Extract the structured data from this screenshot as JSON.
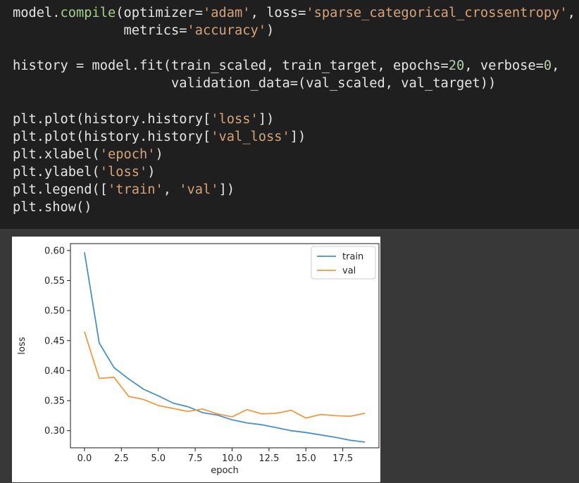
{
  "code_cell": {
    "lines": [
      [
        {
          "t": "model."
        },
        {
          "t": "compile",
          "k": "fn"
        },
        {
          "t": "(optimizer="
        },
        {
          "t": "'adam'",
          "k": "str"
        },
        {
          "t": ", loss="
        },
        {
          "t": "'sparse_categorical_crossentropy'",
          "k": "str"
        },
        {
          "t": ","
        }
      ],
      [
        {
          "t": "              metrics="
        },
        {
          "t": "'accuracy'",
          "k": "str"
        },
        {
          "t": ")"
        }
      ],
      [],
      [
        {
          "t": "history = model.fit(train_scaled, train_target, epochs="
        },
        {
          "t": "20",
          "k": "num"
        },
        {
          "t": ", verbose="
        },
        {
          "t": "0",
          "k": "num"
        },
        {
          "t": ","
        }
      ],
      [
        {
          "t": "                    validation_data=(val_scaled, val_target))"
        }
      ],
      [],
      [
        {
          "t": "plt.plot(history.history["
        },
        {
          "t": "'loss'",
          "k": "str"
        },
        {
          "t": "])"
        }
      ],
      [
        {
          "t": "plt.plot(history.history["
        },
        {
          "t": "'val_loss'",
          "k": "str"
        },
        {
          "t": "])"
        }
      ],
      [
        {
          "t": "plt.xlabel("
        },
        {
          "t": "'epoch'",
          "k": "str"
        },
        {
          "t": ")"
        }
      ],
      [
        {
          "t": "plt.ylabel("
        },
        {
          "t": "'loss'",
          "k": "str"
        },
        {
          "t": ")"
        }
      ],
      [
        {
          "t": "plt.legend(["
        },
        {
          "t": "'train'",
          "k": "str"
        },
        {
          "t": ", "
        },
        {
          "t": "'val'",
          "k": "str"
        },
        {
          "t": "])"
        }
      ],
      [
        {
          "t": "plt.show()"
        }
      ]
    ]
  },
  "chart_data": {
    "type": "line",
    "xlabel": "epoch",
    "ylabel": "loss",
    "xlim": [
      -0.95,
      19.95
    ],
    "ylim": [
      0.2715,
      0.6115
    ],
    "x_ticks": [
      0.0,
      2.5,
      5.0,
      7.5,
      10.0,
      12.5,
      15.0,
      17.5
    ],
    "x_tick_labels": [
      "0.0",
      "2.5",
      "5.0",
      "7.5",
      "10.0",
      "12.5",
      "15.0",
      "17.5"
    ],
    "y_ticks": [
      0.3,
      0.35,
      0.4,
      0.45,
      0.5,
      0.55,
      0.6
    ],
    "y_tick_labels": [
      "0.30",
      "0.35",
      "0.40",
      "0.45",
      "0.50",
      "0.55",
      "0.60"
    ],
    "grid": false,
    "legend_position": "top-right",
    "x": [
      0,
      1,
      2,
      3,
      4,
      5,
      6,
      7,
      8,
      9,
      10,
      11,
      12,
      13,
      14,
      15,
      16,
      17,
      18,
      19
    ],
    "series": [
      {
        "name": "train",
        "color": "#4a90c0",
        "values": [
          0.597,
          0.446,
          0.405,
          0.386,
          0.369,
          0.358,
          0.346,
          0.34,
          0.33,
          0.326,
          0.318,
          0.313,
          0.31,
          0.305,
          0.3,
          0.297,
          0.293,
          0.289,
          0.284,
          0.281
        ]
      },
      {
        "name": "val",
        "color": "#ef9a40",
        "values": [
          0.465,
          0.387,
          0.389,
          0.357,
          0.352,
          0.342,
          0.337,
          0.332,
          0.336,
          0.328,
          0.323,
          0.335,
          0.328,
          0.329,
          0.334,
          0.321,
          0.327,
          0.325,
          0.324,
          0.329
        ]
      }
    ]
  }
}
